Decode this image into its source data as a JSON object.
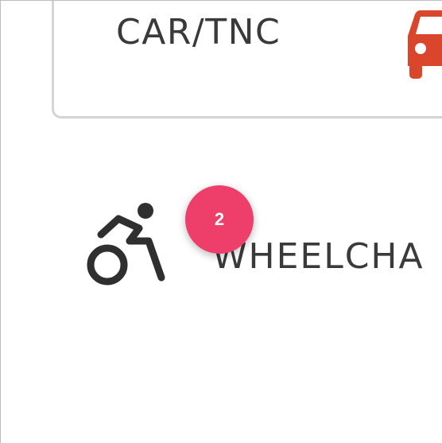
{
  "options": {
    "car": {
      "label": "CAR/TNC",
      "icon": "car-icon",
      "icon_color": "#d9462b"
    },
    "wheelchair": {
      "label": "WHEELCHA",
      "icon": "wheelchair-icon",
      "icon_color": "#2f2f2f"
    }
  },
  "badge": {
    "value": "2",
    "color": "#ee3f6b"
  }
}
